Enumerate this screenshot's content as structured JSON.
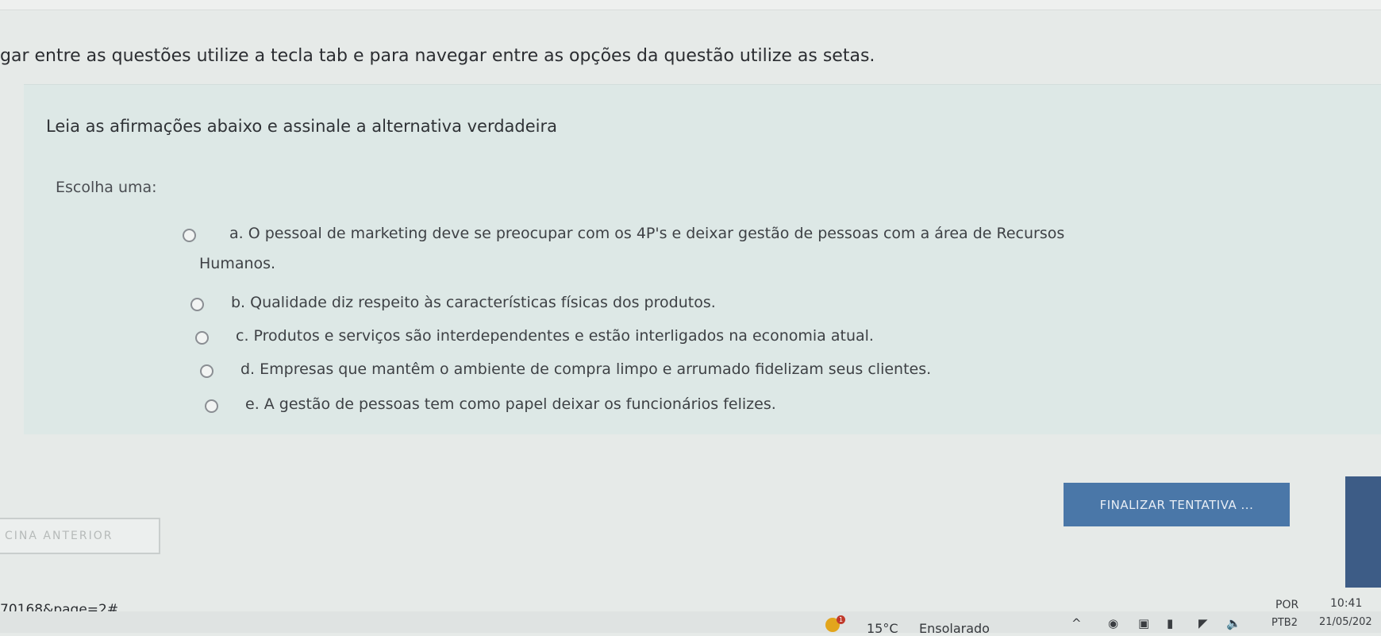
{
  "instructions": "gar entre as questões utilize a tecla tab e para navegar entre as opções da questão utilize as setas.",
  "question": {
    "text": "Leia as afirmações abaixo e assinale a alternativa verdadeira",
    "choose_label": "Escolha uma:",
    "options": [
      {
        "line1": "a. O pessoal de marketing deve se preocupar com os 4P's e deixar gestão de pessoas com a área de Recursos",
        "line2": "Humanos.",
        "selected": false
      },
      {
        "text": "b. Qualidade diz respeito às características físicas dos produtos.",
        "selected": false
      },
      {
        "text": "c. Produtos e serviços são interdependentes e estão interligados na economia atual.",
        "selected": false
      },
      {
        "text": "d. Empresas que mantêm o ambiente de compra limpo e arrumado fidelizam seus clientes.",
        "selected": false
      },
      {
        "text": "e. A gestão de pessoas tem como papel deixar os funcionários felizes.",
        "selected": false
      }
    ]
  },
  "navigation": {
    "finalize_label": "FINALIZAR TENTATIVA ...",
    "previous_label": "CINA ANTERIOR"
  },
  "status_url": "70168&page=2#",
  "taskbar": {
    "weather_alert": "1",
    "temperature": "15°C",
    "weather_text": "Ensolarado",
    "lang_top": "POR",
    "lang_bottom": "PTB2",
    "time": "10:41",
    "date": "21/05/202"
  },
  "colors": {
    "question_bg": "#dde8e6",
    "finalize_bg": "#4a77a8",
    "accent": "#3d5c86"
  }
}
